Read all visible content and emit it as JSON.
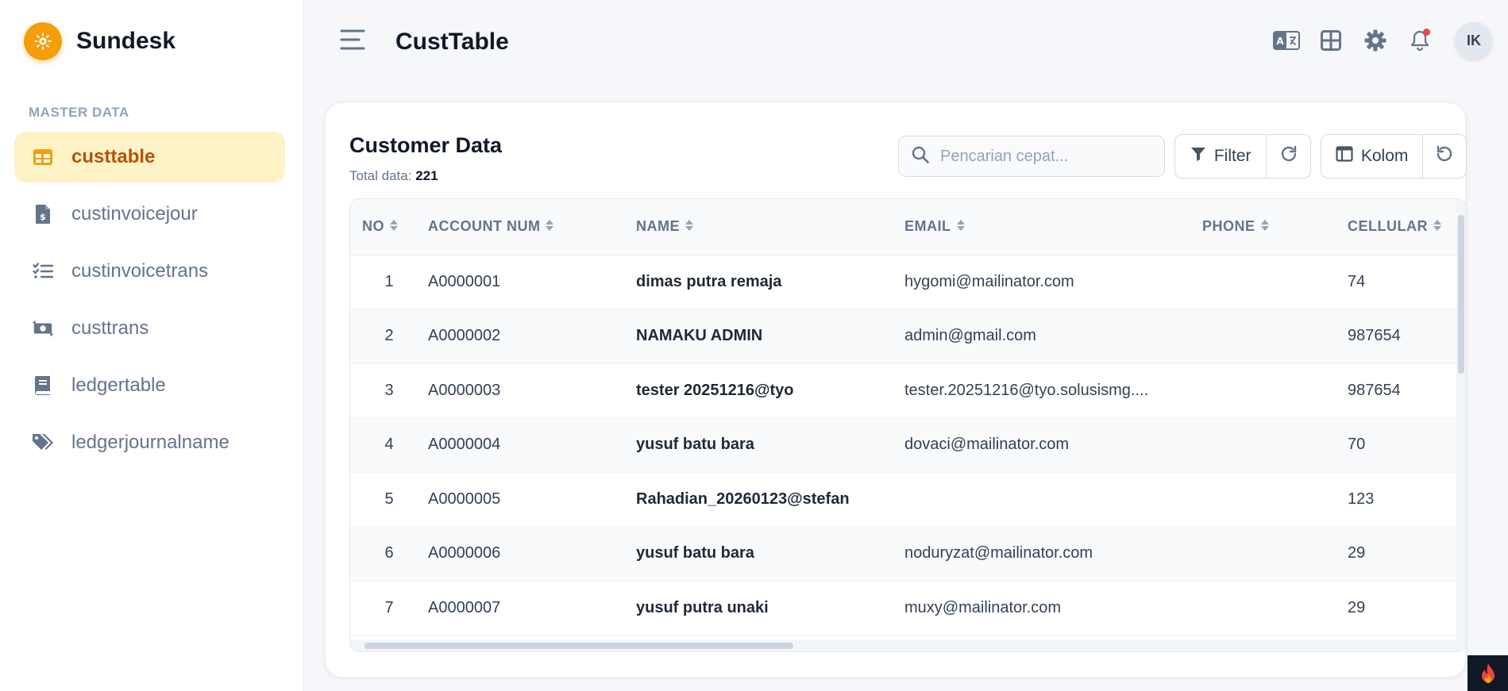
{
  "brand": {
    "name": "Sundesk"
  },
  "sidebar": {
    "section_label": "MASTER DATA",
    "items": [
      {
        "label": "custtable",
        "icon": "table-icon",
        "active": true
      },
      {
        "label": "custinvoicejour",
        "icon": "invoice-icon",
        "active": false
      },
      {
        "label": "custinvoicetrans",
        "icon": "list-check-icon",
        "active": false
      },
      {
        "label": "custtrans",
        "icon": "money-transfer-icon",
        "active": false
      },
      {
        "label": "ledgertable",
        "icon": "book-icon",
        "active": false
      },
      {
        "label": "ledgerjournalname",
        "icon": "tags-icon",
        "active": false
      }
    ]
  },
  "header": {
    "title": "CustTable",
    "avatar_initials": "IK"
  },
  "card": {
    "title": "Customer Data",
    "total_label": "Total data:",
    "total_value": "221",
    "search_placeholder": "Pencarian cepat...",
    "filter_label": "Filter",
    "columns_label": "Kolom"
  },
  "table": {
    "headers": [
      "NO",
      "ACCOUNT NUM",
      "NAME",
      "EMAIL",
      "PHONE",
      "CELLULAR"
    ],
    "rows": [
      {
        "no": "1",
        "account": "A0000001",
        "name": "dimas putra remaja",
        "email": "hygomi@mailinator.com",
        "phone": "",
        "cellular": "74"
      },
      {
        "no": "2",
        "account": "A0000002",
        "name": "NAMAKU ADMIN",
        "email": "admin@gmail.com",
        "phone": "",
        "cellular": "987654"
      },
      {
        "no": "3",
        "account": "A0000003",
        "name": "tester 20251216@tyo",
        "email": "tester.20251216@tyo.solusismg....",
        "phone": "",
        "cellular": "987654"
      },
      {
        "no": "4",
        "account": "A0000004",
        "name": "yusuf batu bara",
        "email": "dovaci@mailinator.com",
        "phone": "",
        "cellular": "70"
      },
      {
        "no": "5",
        "account": "A0000005",
        "name": "Rahadian_20260123@stefan",
        "email": "",
        "phone": "",
        "cellular": "123"
      },
      {
        "no": "6",
        "account": "A0000006",
        "name": "yusuf batu bara",
        "email": "noduryzat@mailinator.com",
        "phone": "",
        "cellular": "29"
      },
      {
        "no": "7",
        "account": "A0000007",
        "name": "yusuf putra unaki",
        "email": "muxy@mailinator.com",
        "phone": "",
        "cellular": "29"
      }
    ]
  },
  "colors": {
    "accent": "#f59e0b",
    "active_bg": "#fef3c7",
    "active_text": "#b45309",
    "notification": "#ef4444"
  }
}
